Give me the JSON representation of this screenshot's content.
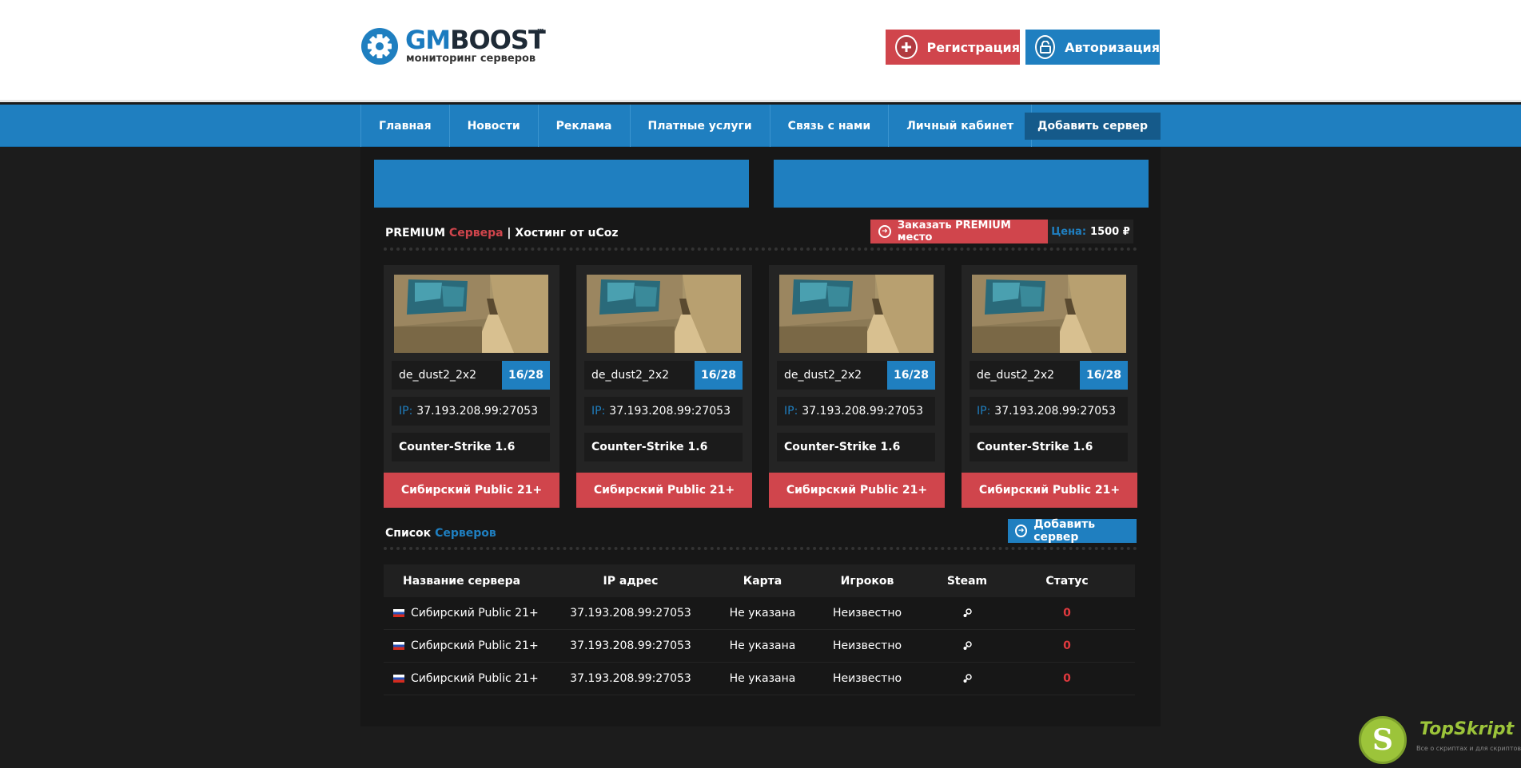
{
  "header": {
    "logo_gm": "GM",
    "logo_boost": "BOOST",
    "logo_tm": "™",
    "logo_sub": "мониторинг серверов",
    "register_label": "Регистрация",
    "login_label": "Авторизация"
  },
  "nav": {
    "items": [
      "Главная",
      "Новости",
      "Реклама",
      "Платные услуги",
      "Связь с нами",
      "Личный кабинет"
    ],
    "add_server_label": "Добавить сервер"
  },
  "premium": {
    "title_premium": "PREMIUM",
    "title_servers": "Сервера",
    "title_sep": "|",
    "title_hosting": "Хостинг от uCoz",
    "order_label": "Заказать PREMIUM место",
    "price_label": "Цена:",
    "price_value": "1500 ₽",
    "cards": [
      {
        "map": "de_dust2_2x2",
        "slots": "16/28",
        "ip_label": "IP:",
        "ip": "37.193.208.99:27053",
        "game": "Counter-Strike 1.6",
        "name": "Сибирский Public 21+"
      },
      {
        "map": "de_dust2_2x2",
        "slots": "16/28",
        "ip_label": "IP:",
        "ip": "37.193.208.99:27053",
        "game": "Counter-Strike 1.6",
        "name": "Сибирский Public 21+"
      },
      {
        "map": "de_dust2_2x2",
        "slots": "16/28",
        "ip_label": "IP:",
        "ip": "37.193.208.99:27053",
        "game": "Counter-Strike 1.6",
        "name": "Сибирский Public 21+"
      },
      {
        "map": "de_dust2_2x2",
        "slots": "16/28",
        "ip_label": "IP:",
        "ip": "37.193.208.99:27053",
        "game": "Counter-Strike 1.6",
        "name": "Сибирский Public 21+"
      }
    ]
  },
  "list": {
    "title_list": "Список",
    "title_servers": "Серверов",
    "add_label": "Добавить сервер",
    "columns": [
      "Название сервера",
      "IP адрес",
      "Карта",
      "Игроков",
      "Steam",
      "Статус"
    ],
    "rows": [
      {
        "name": "Сибирский Public 21+",
        "ip": "37.193.208.99:27053",
        "map": "Не указана",
        "players": "Неизвестно",
        "status": "0"
      },
      {
        "name": "Сибирский Public 21+",
        "ip": "37.193.208.99:27053",
        "map": "Не указана",
        "players": "Неизвестно",
        "status": "0"
      },
      {
        "name": "Сибирский Public 21+",
        "ip": "37.193.208.99:27053",
        "map": "Не указана",
        "players": "Неизвестно",
        "status": "0"
      }
    ]
  },
  "watermark": {
    "letter": "S",
    "name": "TopSkript",
    "sub": "Все о скриптах и для скриптов..."
  },
  "colors": {
    "brand_blue": "#1f7fc0",
    "brand_red": "#d0454c",
    "background": "#1c1c1c"
  }
}
